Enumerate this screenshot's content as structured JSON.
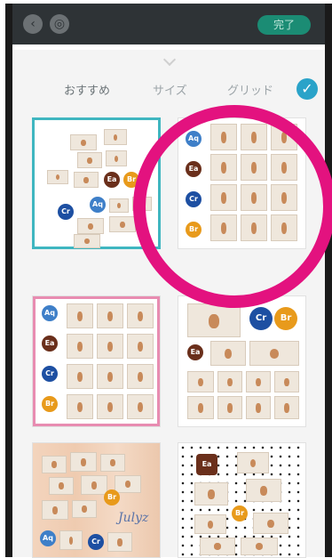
{
  "top_bar": {
    "back_icon": "chevron-left-icon",
    "layers_icon": "layers-icon",
    "done_label": "完了"
  },
  "sheet": {
    "tabs": [
      "おすすめ",
      "サイズ",
      "グリッド"
    ],
    "active_tab": "おすすめ",
    "confirm_icon": "check-icon"
  },
  "templates": [
    {
      "id": "scattered-white",
      "selected": true
    },
    {
      "id": "grid-icons",
      "selected": false
    },
    {
      "id": "pink-grid",
      "selected": false
    },
    {
      "id": "collage-badges",
      "selected": false
    },
    {
      "id": "wood-collage",
      "selected": false
    },
    {
      "id": "dots-collage",
      "selected": false
    }
  ],
  "badges": {
    "aq": "Aq",
    "ea": "Ea",
    "cr": "Cr",
    "br": "Br"
  },
  "collage_script_text": "Julyz",
  "colors": {
    "topbar": "#2e3336",
    "done": "#1b8c74",
    "selected_border": "#3fb6c0",
    "highlight_circle": "#e3127f",
    "pink_grid": "#e88cb1"
  }
}
